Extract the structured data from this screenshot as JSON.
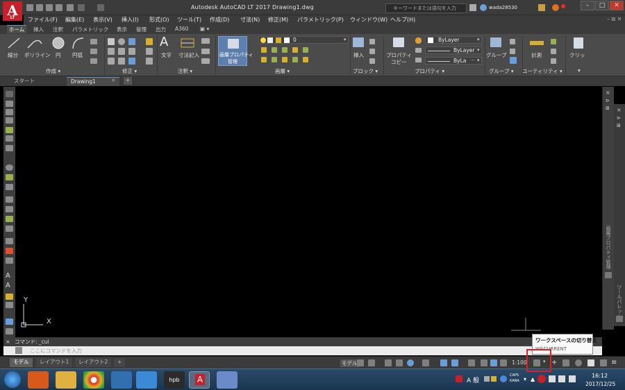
{
  "titlebar": {
    "title": "Autodesk AutoCAD LT 2017    Drawing1.dwg",
    "search_placeholder": "キーワードまたは語句を入力",
    "user": "wada28530"
  },
  "menu": [
    "ファイル(F)",
    "編集(E)",
    "表示(V)",
    "挿入(I)",
    "形式(O)",
    "ツール(T)",
    "作成(D)",
    "寸法(N)",
    "修正(M)",
    "パラメトリック(P)",
    "ウィンドウ(W)",
    "ヘルプ(H)"
  ],
  "ribbon_tabs": [
    "ホーム",
    "挿入",
    "注釈",
    "パラメトリック",
    "表示",
    "管理",
    "出力",
    "A360"
  ],
  "ribbon": {
    "draw_tools": [
      "線分",
      "ポリライン",
      "円",
      "円弧"
    ],
    "text_tool": "文字",
    "dim_tool": "寸法記入",
    "layer_props_line1": "画層プロパティ",
    "layer_props_line2": "管理",
    "layer_current": "0",
    "insert_tool": "挿入",
    "props_copy_line1": "プロパティ",
    "props_copy_line2": "コピー",
    "bylayer_1": "ByLayer",
    "bylayer_2": "ByLayer",
    "bylayer_3": "ByLa",
    "group_tool": "グループ",
    "measure_tool": "計測",
    "clipboard_tool": "クリッ",
    "panels": [
      "作成 ▾",
      "修正 ▾",
      "注釈 ▾",
      "画層 ▾",
      "ブロック ▾",
      "プロパティ ▾",
      "グループ ▾",
      "ユーティリティ ▾"
    ]
  },
  "file_tabs": [
    "スタート",
    "Drawing1"
  ],
  "right_palette_label": "画層プロパティ管理",
  "right_palette2_label": "ツールパレット",
  "ucs": {
    "x_label": "X",
    "y_label": "Y"
  },
  "command": {
    "history": "コマンド: _cui",
    "placeholder": "ここにコマンドを入力"
  },
  "layout_tabs": [
    "モデル",
    "レイアウト1",
    "レイアウト2"
  ],
  "status": {
    "model_label": "モデル",
    "scale": "1:100"
  },
  "tooltip": {
    "title": "ワークスペースの切り替え",
    "subtitle": "WSCURRENT"
  },
  "taskbar": {
    "ime": "A 般",
    "caps": "CAPS",
    "kana": "KANA",
    "time": "16:12",
    "date": "2017/12/25"
  },
  "colors": {
    "accent_red": "#c8202a",
    "highlight_box": "#e02020",
    "layer_blue": "#4f86c6"
  }
}
